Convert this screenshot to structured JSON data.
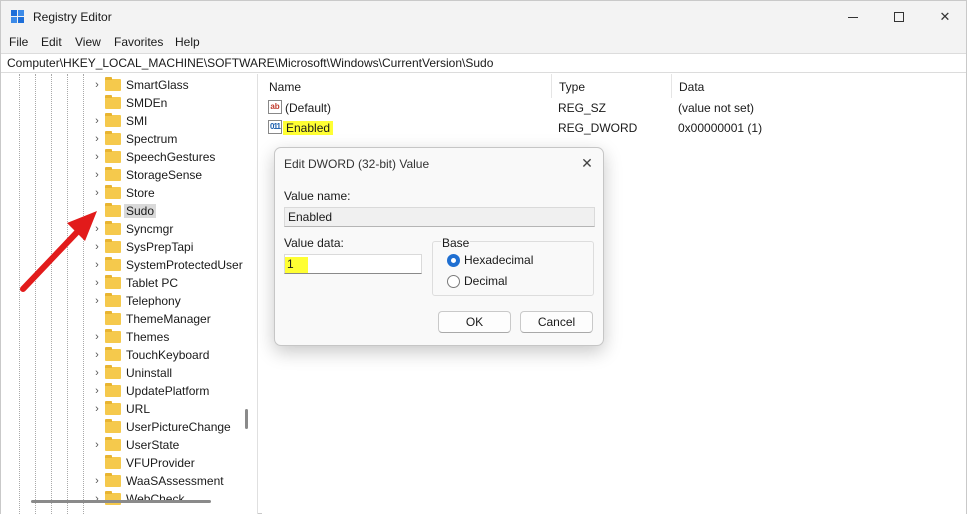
{
  "window": {
    "title": "Registry Editor"
  },
  "menu": [
    "File",
    "Edit",
    "View",
    "Favorites",
    "Help"
  ],
  "address": "Computer\\HKEY_LOCAL_MACHINE\\SOFTWARE\\Microsoft\\Windows\\CurrentVersion\\Sudo",
  "tree": {
    "items": [
      {
        "label": "SmartGlass",
        "expandable": true
      },
      {
        "label": "SMDEn",
        "expandable": false
      },
      {
        "label": "SMI",
        "expandable": true
      },
      {
        "label": "Spectrum",
        "expandable": true
      },
      {
        "label": "SpeechGestures",
        "expandable": true
      },
      {
        "label": "StorageSense",
        "expandable": true
      },
      {
        "label": "Store",
        "expandable": true
      },
      {
        "label": "Sudo",
        "expandable": false,
        "selected": true
      },
      {
        "label": "Syncmgr",
        "expandable": true
      },
      {
        "label": "SysPrepTapi",
        "expandable": true
      },
      {
        "label": "SystemProtectedUser",
        "expandable": true
      },
      {
        "label": "Tablet PC",
        "expandable": true
      },
      {
        "label": "Telephony",
        "expandable": true
      },
      {
        "label": "ThemeManager",
        "expandable": false
      },
      {
        "label": "Themes",
        "expandable": true
      },
      {
        "label": "TouchKeyboard",
        "expandable": true
      },
      {
        "label": "Uninstall",
        "expandable": true
      },
      {
        "label": "UpdatePlatform",
        "expandable": true
      },
      {
        "label": "URL",
        "expandable": true
      },
      {
        "label": "UserPictureChange",
        "expandable": false
      },
      {
        "label": "UserState",
        "expandable": true
      },
      {
        "label": "VFUProvider",
        "expandable": false
      },
      {
        "label": "WaaSAssessment",
        "expandable": true
      },
      {
        "label": "WebCheck",
        "expandable": true
      }
    ]
  },
  "list": {
    "columns": [
      "Name",
      "Type",
      "Data"
    ],
    "rows": [
      {
        "icon": "string-value-icon",
        "glyph": "ab",
        "name": "(Default)",
        "type": "REG_SZ",
        "data": "(value not set)",
        "highlight": false
      },
      {
        "icon": "dword-value-icon",
        "glyph": "011",
        "name": "Enabled",
        "type": "REG_DWORD",
        "data": "0x00000001 (1)",
        "highlight": true
      }
    ]
  },
  "dialog": {
    "title": "Edit DWORD (32-bit) Value",
    "close_glyph": "✕",
    "value_name_label": "Value name:",
    "value_name": "Enabled",
    "value_data_label": "Value data:",
    "value_data": "1",
    "base_label": "Base",
    "base_options": [
      {
        "label": "Hexadecimal",
        "selected": true
      },
      {
        "label": "Decimal",
        "selected": false
      }
    ],
    "ok_label": "OK",
    "cancel_label": "Cancel"
  },
  "colors": {
    "highlight": "#ffff33",
    "arrow": "#e21b1b",
    "accent": "#1f6fd1",
    "folder": "#f5c94c"
  }
}
